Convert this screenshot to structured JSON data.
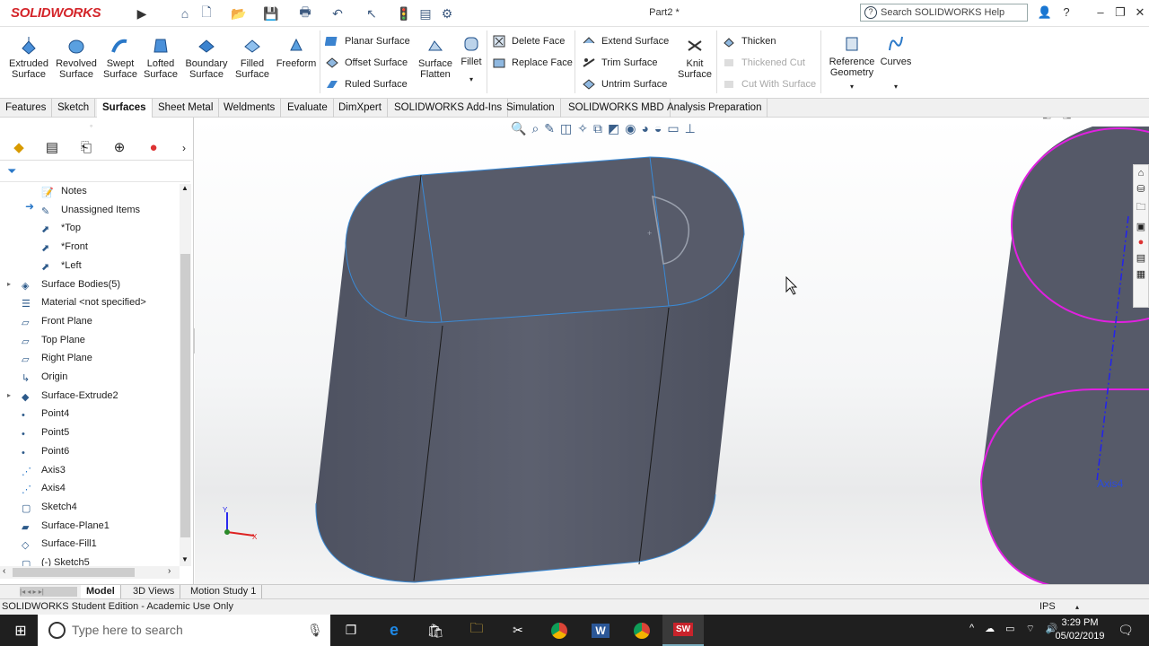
{
  "app": {
    "logo_text": "SOLIDWORKS",
    "doc_title": "Part2 *"
  },
  "search": {
    "placeholder": "Search SOLIDWORKS Help"
  },
  "ribbon": {
    "big_buttons": [
      {
        "label1": "Extruded",
        "label2": "Surface"
      },
      {
        "label1": "Revolved",
        "label2": "Surface"
      },
      {
        "label1": "Swept",
        "label2": "Surface"
      },
      {
        "label1": "Lofted",
        "label2": "Surface"
      },
      {
        "label1": "Boundary",
        "label2": "Surface"
      },
      {
        "label1": "Filled",
        "label2": "Surface"
      },
      {
        "label1": "Freeform",
        "label2": ""
      }
    ],
    "planar": "Planar Surface",
    "offset": "Offset Surface",
    "ruled": "Ruled Surface",
    "flatten1": "Surface",
    "flatten2": "Flatten",
    "fillet": "Fillet",
    "delete_face": "Delete Face",
    "replace_face": "Replace Face",
    "extend": "Extend Surface",
    "trim": "Trim Surface",
    "untrim": "Untrim Surface",
    "knit1": "Knit",
    "knit2": "Surface",
    "thicken": "Thicken",
    "thickened_cut": "Thickened Cut",
    "cut_with_surface": "Cut With Surface",
    "refgeo1": "Reference",
    "refgeo2": "Geometry",
    "curves": "Curves"
  },
  "command_tabs": [
    "Features",
    "Sketch",
    "Surfaces",
    "Sheet Metal",
    "Weldments",
    "Evaluate",
    "DimXpert",
    "SOLIDWORKS Add-Ins",
    "Simulation",
    "SOLIDWORKS MBD",
    "Analysis Preparation"
  ],
  "active_tab": "Surfaces",
  "tree": [
    {
      "label": "Notes",
      "icon": "notes-icon",
      "indent": 1
    },
    {
      "label": "Unassigned Items",
      "icon": "annotation-icon",
      "indent": 1
    },
    {
      "label": "*Top",
      "icon": "annotation-view-icon",
      "indent": 1
    },
    {
      "label": "*Front",
      "icon": "annotation-view-icon",
      "indent": 1
    },
    {
      "label": "*Left",
      "icon": "annotation-view-icon",
      "indent": 1
    },
    {
      "label": "Surface Bodies(5)",
      "icon": "surface-bodies-icon",
      "indent": 0,
      "caret": true
    },
    {
      "label": "Material <not specified>",
      "icon": "material-icon",
      "indent": 0
    },
    {
      "label": "Front Plane",
      "icon": "plane-icon",
      "indent": 0
    },
    {
      "label": "Top Plane",
      "icon": "plane-icon",
      "indent": 0
    },
    {
      "label": "Right Plane",
      "icon": "plane-icon",
      "indent": 0
    },
    {
      "label": "Origin",
      "icon": "origin-icon",
      "indent": 0
    },
    {
      "label": "Surface-Extrude2",
      "icon": "surface-extrude-icon",
      "indent": 0,
      "caret": true
    },
    {
      "label": "Point4",
      "icon": "point-icon",
      "indent": 0
    },
    {
      "label": "Point5",
      "icon": "point-icon",
      "indent": 0
    },
    {
      "label": "Point6",
      "icon": "point-icon",
      "indent": 0
    },
    {
      "label": "Axis3",
      "icon": "axis-icon",
      "indent": 0
    },
    {
      "label": "Axis4",
      "icon": "axis-icon",
      "indent": 0
    },
    {
      "label": "Sketch4",
      "icon": "sketch-icon",
      "indent": 0
    },
    {
      "label": "Surface-Plane1",
      "icon": "surface-plane-icon",
      "indent": 0
    },
    {
      "label": "Surface-Fill1",
      "icon": "surface-fill-icon",
      "indent": 0
    },
    {
      "label": "(-) Sketch5",
      "icon": "sketch-icon",
      "indent": 0
    }
  ],
  "viewport": {
    "axis_label": "Axis4",
    "triad_y": "Y",
    "triad_x": "X"
  },
  "bottom_tabs": [
    "Model",
    "3D Views",
    "Motion Study 1"
  ],
  "status": {
    "left": "SOLIDWORKS Student Edition - Academic Use Only",
    "units": "IPS"
  },
  "taskbar": {
    "search_placeholder": "Type here to search",
    "time": "3:29 PM",
    "date": "05/02/2019"
  },
  "colors": {
    "accent_blue": "#2a78c8",
    "surface_gray": "#5b5f6e",
    "magenta_edge": "#e020e0"
  }
}
